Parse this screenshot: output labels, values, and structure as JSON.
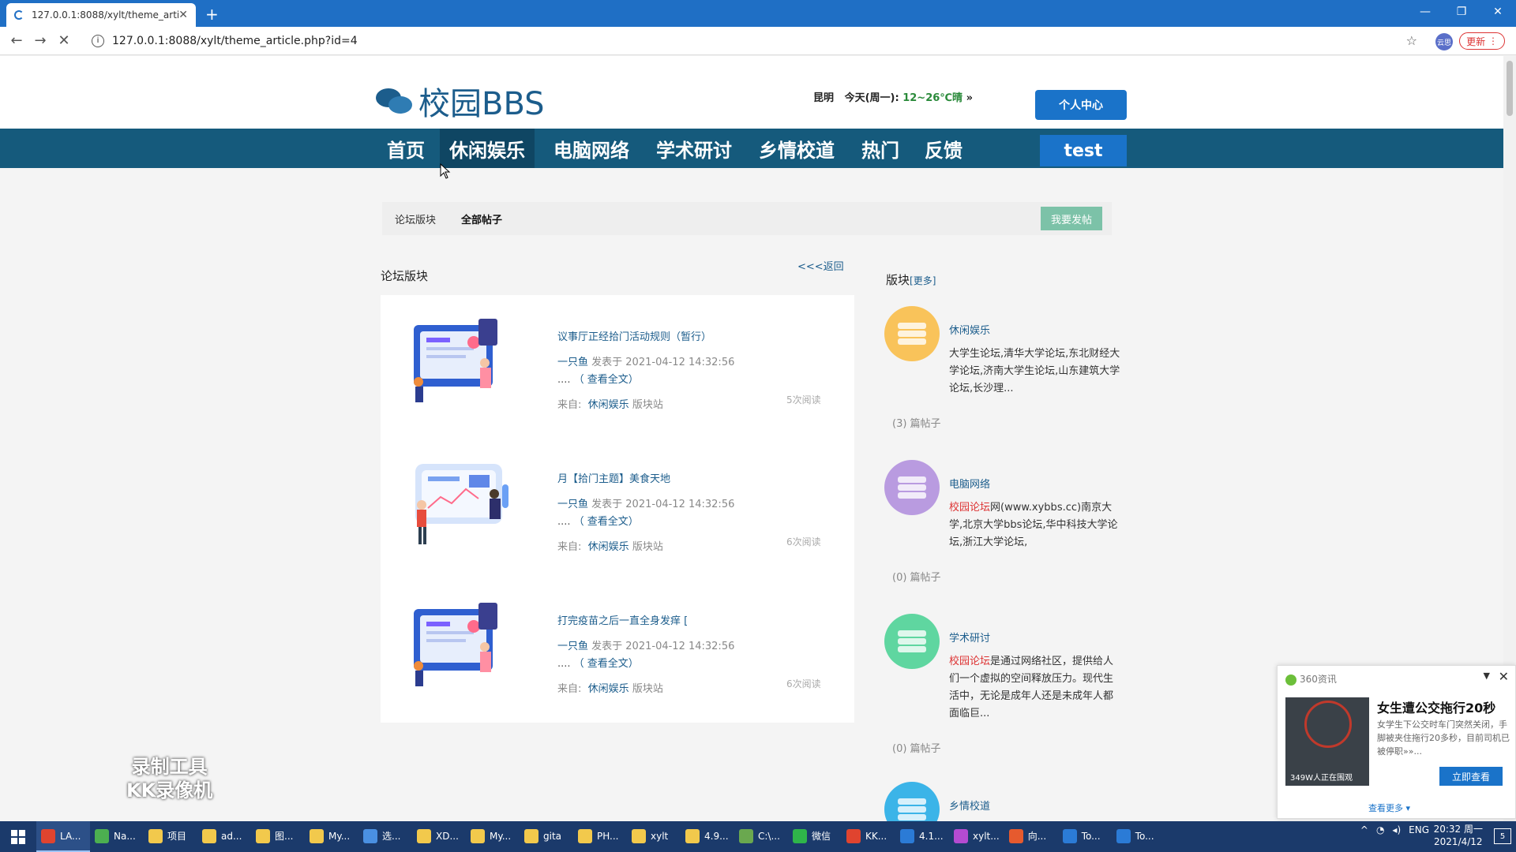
{
  "browser": {
    "tab_title": "127.0.0.1:8088/xylt/theme_artic",
    "url": "127.0.0.1:8088/xylt/theme_article.php?id=4",
    "update_label": "更新",
    "profile_label": "云思"
  },
  "site": {
    "logo_text": "校园BBS",
    "weather": {
      "city": "昆明",
      "day": "今天(周一):",
      "temp": "12~26℃晴",
      "arrow": "»"
    },
    "user_center": "个人中心",
    "username": "test",
    "nav": [
      "首页",
      "休闲娱乐",
      "电脑网络",
      "学术研讨",
      "乡情校道",
      "热门",
      "反馈"
    ],
    "active_nav": "休闲娱乐"
  },
  "crumbs": {
    "forum": "论坛版块",
    "all_posts": "全部帖子",
    "post_button": "我要发帖"
  },
  "list": {
    "section_title": "论坛版块",
    "back_label": "<<<返回",
    "items": [
      {
        "title": "议事厅正经拾门活动规则（暂行）",
        "author": "一只鱼",
        "posted": "发表于 2021-04-12 14:32:56",
        "more_prefix": "....",
        "more_label": "（ 查看全文）",
        "src_label": "来自:",
        "src_board": "休闲娱乐",
        "src_suffix": "版块站",
        "reads": "5次阅读"
      },
      {
        "title": "月【拾门主题】美食天地",
        "author": "一只鱼",
        "posted": "发表于 2021-04-12 14:32:56",
        "more_prefix": "....",
        "more_label": "（ 查看全文）",
        "src_label": "来自:",
        "src_board": "休闲娱乐",
        "src_suffix": "版块站",
        "reads": "6次阅读"
      },
      {
        "title": "打完疫苗之后一直全身发痒 [",
        "author": "一只鱼",
        "posted": "发表于 2021-04-12 14:32:56",
        "more_prefix": "....",
        "more_label": "（ 查看全文）",
        "src_label": "来自:",
        "src_board": "休闲娱乐",
        "src_suffix": "版块站",
        "reads": "6次阅读"
      }
    ]
  },
  "boards": {
    "title": "版块",
    "more": "[更多]",
    "items": [
      {
        "name": "休闲娱乐",
        "highlight": "",
        "desc": "大学生论坛,清华大学论坛,东北财经大学论坛,济南大学生论坛,山东建筑大学论坛,长沙理...",
        "count": "(3)  篇帖子",
        "color": "#f9c35a"
      },
      {
        "name": "电脑网络",
        "highlight": "校园论坛",
        "desc": "网(www.xybbs.cc)南京大学,北京大学bbs论坛,华中科技大学论坛,浙江大学论坛,",
        "count": "(0)  篇帖子",
        "color": "#b99be0"
      },
      {
        "name": "学术研讨",
        "highlight": "校园论坛",
        "desc": "是通过网络社区，提供给人们一个虚拟的空间释放压力。现代生活中，无论是成年人还是未成年人都面临巨...",
        "count": "(0)  篇帖子",
        "color": "#5fd6a0"
      },
      {
        "name": "乡情校道",
        "highlight": "",
        "desc": "",
        "count": "",
        "color": "#3bb4e8"
      }
    ]
  },
  "watermark": {
    "line1": "录制工具",
    "line2": "KK录像机"
  },
  "popup": {
    "source": "360资讯",
    "title": "女生遭公交拖行20秒",
    "desc": "女学生下公交时车门突然关闭，手脚被夹住拖行20多秒，目前司机已被停职»»...",
    "viewers": "349W人正在围观",
    "button": "立即查看",
    "more": "查看更多 ▾"
  },
  "taskbar": {
    "items": [
      {
        "label": "LA...",
        "color": "#e0442f"
      },
      {
        "label": "Na...",
        "color": "#4caf50"
      },
      {
        "label": "项目",
        "color": "#f2c94c"
      },
      {
        "label": "ad...",
        "color": "#f2c94c"
      },
      {
        "label": "图...",
        "color": "#f2c94c"
      },
      {
        "label": "My...",
        "color": "#f2c94c"
      },
      {
        "label": "选...",
        "color": "#4a90e2"
      },
      {
        "label": "XD...",
        "color": "#f2c94c"
      },
      {
        "label": "My...",
        "color": "#f2c94c"
      },
      {
        "label": "gita",
        "color": "#f2c94c"
      },
      {
        "label": "PH...",
        "color": "#f2c94c"
      },
      {
        "label": "xylt",
        "color": "#f2c94c"
      },
      {
        "label": "4.9...",
        "color": "#f2c94c"
      },
      {
        "label": "C:\\...",
        "color": "#6aa84f"
      },
      {
        "label": "微信",
        "color": "#2fb54a"
      },
      {
        "label": "KK...",
        "color": "#e0442f"
      },
      {
        "label": "4.1...",
        "color": "#2b7bd6"
      },
      {
        "label": "xylt...",
        "color": "#b44bd1"
      },
      {
        "label": "向...",
        "color": "#e65a2e"
      },
      {
        "label": "To...",
        "color": "#2b7bd6"
      },
      {
        "label": "To...",
        "color": "#2b7bd6"
      }
    ],
    "lang": "ENG",
    "time": "20:32 周一",
    "date": "2021/4/12",
    "notif": "5"
  }
}
